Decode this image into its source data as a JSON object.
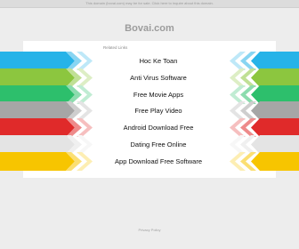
{
  "page": {
    "notice": "This domain (bovai.com) may be for sale. Click here to inquire about this domain.",
    "domain": "Bovai.com",
    "related_label": "Related Links",
    "footer": "Privacy Policy"
  },
  "links": [
    {
      "label": "Hoc Ke Toan",
      "color": "#26b3e8"
    },
    {
      "label": "Anti Virus Software",
      "color": "#8cc63f"
    },
    {
      "label": "Free Movie Apps",
      "color": "#2dbf6c"
    },
    {
      "label": "Free Play Video",
      "color": "#a6a6a6"
    },
    {
      "label": "Android Download Free",
      "color": "#e02a2a"
    },
    {
      "label": "Dating Free Online",
      "color": "#e4e4e4"
    },
    {
      "label": "App Download Free Software",
      "color": "#f7c500"
    }
  ]
}
